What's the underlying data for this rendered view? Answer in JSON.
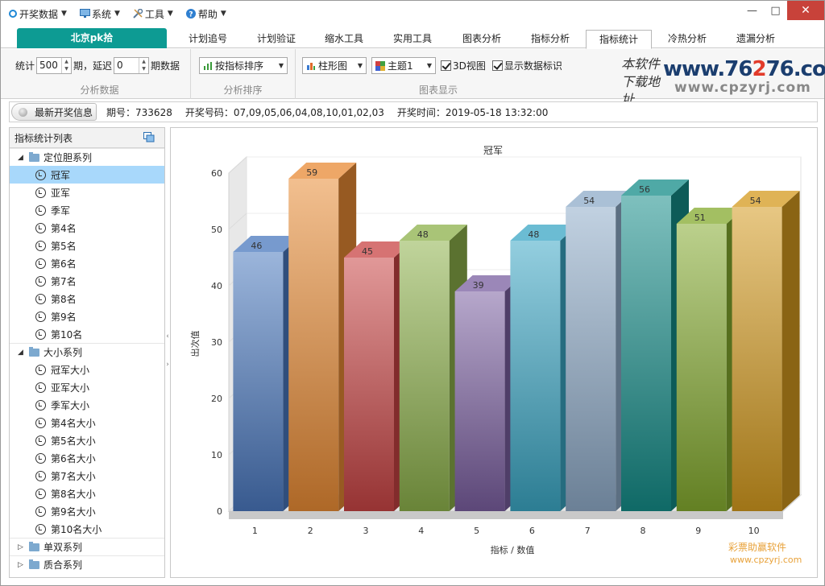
{
  "menu": {
    "items": [
      {
        "name": "menu-open-data",
        "icon": "ring-icon",
        "label": "开奖数据"
      },
      {
        "name": "menu-system",
        "icon": "monitor-icon",
        "label": "系统"
      },
      {
        "name": "menu-tools",
        "icon": "wrench-icon",
        "label": "工具"
      },
      {
        "name": "menu-help",
        "icon": "help-icon",
        "label": "帮助"
      }
    ]
  },
  "tabs": {
    "main": "北京pk拾",
    "items": [
      "计划追号",
      "计划验证",
      "缩水工具",
      "实用工具",
      "图表分析",
      "指标分析",
      "指标统计",
      "冷热分析",
      "遗漏分析"
    ],
    "active": "指标统计"
  },
  "toolbar": {
    "stat_prefix": "统计",
    "stat_value": "500",
    "stat_mid": "期，延迟",
    "delay_value": "0",
    "delay_suffix": "期数据",
    "group1_caption": "分析数据",
    "sort_label": "按指标排序",
    "group2_caption": "分析排序",
    "chart_type": "柱形图",
    "theme": "主题1",
    "view3d_label": "3D视图",
    "show_labels_label": "显示数据标识",
    "group3_caption": "图表显示"
  },
  "logo": {
    "calig_line1": "本软件",
    "calig_line2": "下载地址",
    "url_a": "www.76",
    "url_b": "2",
    "url_c": "76.com",
    "url2": "www.cpzyrj.com"
  },
  "infobar": {
    "button": "最新开奖信息",
    "period_label": "期号：",
    "period": "733628",
    "numbers_label": "开奖号码：",
    "numbers": "07,09,05,06,04,08,10,01,02,03",
    "time_label": "开奖时间：",
    "time": "2019-05-18 13:32:00"
  },
  "sidebar": {
    "title": "指标统计列表",
    "groups": [
      {
        "label": "定位胆系列",
        "expanded": true,
        "items": [
          "冠军",
          "亚军",
          "季军",
          "第4名",
          "第5名",
          "第6名",
          "第7名",
          "第8名",
          "第9名",
          "第10名"
        ]
      },
      {
        "label": "大小系列",
        "expanded": true,
        "items": [
          "冠军大小",
          "亚军大小",
          "季军大小",
          "第4名大小",
          "第5名大小",
          "第6名大小",
          "第7名大小",
          "第8名大小",
          "第9名大小",
          "第10名大小"
        ]
      },
      {
        "label": "单双系列",
        "expanded": false,
        "items": []
      },
      {
        "label": "质合系列",
        "expanded": false,
        "items": []
      }
    ],
    "selected": "冠军"
  },
  "chart_data": {
    "type": "bar",
    "title": "冠军",
    "xlabel": "指标 / 数值",
    "ylabel": "出次值",
    "categories": [
      "1",
      "2",
      "3",
      "4",
      "5",
      "6",
      "7",
      "8",
      "9",
      "10"
    ],
    "values": [
      46,
      59,
      45,
      48,
      39,
      48,
      54,
      56,
      51,
      54
    ],
    "ylim": [
      0,
      60
    ],
    "yticks": [
      0,
      10,
      20,
      30,
      40,
      50,
      60
    ],
    "view3d": true,
    "grid": true,
    "colors": [
      "#4a78be",
      "#e88a34",
      "#c84444",
      "#8cb04a",
      "#7a5fa0",
      "#3aa6c4",
      "#8eabc8",
      "#148c88",
      "#84aa2e",
      "#d49a1e"
    ]
  },
  "watermark": {
    "line1": "彩票助赢软件",
    "line2": "www.cpzyrj.com"
  }
}
